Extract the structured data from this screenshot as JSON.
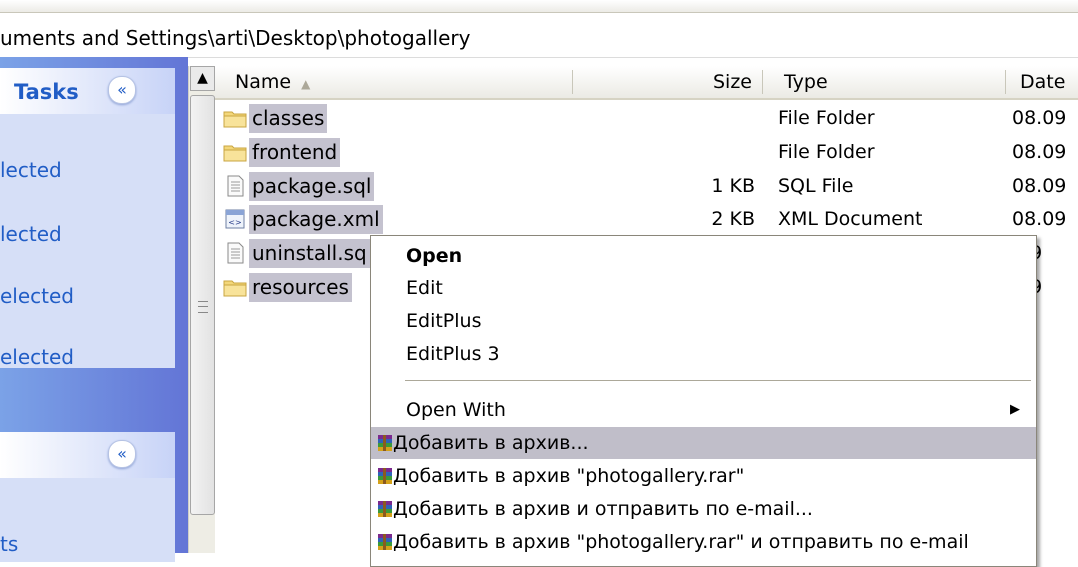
{
  "address": {
    "path": "uments and Settings\\arti\\Desktop\\photogallery"
  },
  "task_pane": {
    "panel1": {
      "header": "Tasks",
      "items": [
        "lected",
        "lected",
        "elected",
        "elected"
      ]
    },
    "panel2": {
      "header": "",
      "items": [
        "ts"
      ]
    },
    "collapse_glyph": "«"
  },
  "columns": {
    "name": "Name",
    "size": "Size",
    "type": "Type",
    "date": "Date"
  },
  "files": [
    {
      "name": "classes",
      "size": "",
      "type": "File Folder",
      "date": "08.09",
      "icon": "folder-icon"
    },
    {
      "name": "frontend",
      "size": "",
      "type": "File Folder",
      "date": "08.09",
      "icon": "folder-icon"
    },
    {
      "name": "package.sql",
      "size": "1 KB",
      "type": "SQL File",
      "date": "08.09",
      "icon": "text-file-icon"
    },
    {
      "name": "package.xml",
      "size": "2 KB",
      "type": "XML Document",
      "date": "08.09",
      "icon": "xml-file-icon"
    },
    {
      "name": "uninstall.sq",
      "size": "",
      "type": "",
      "date": ".09",
      "icon": "text-file-icon"
    },
    {
      "name": "resources",
      "size": "",
      "type": "",
      "date": ".09",
      "icon": "folder-icon"
    }
  ],
  "context_menu": {
    "open": "Open",
    "edit": "Edit",
    "editplus": "EditPlus",
    "editplus3": "EditPlus 3",
    "open_with": "Open With",
    "add_archive": "Добавить в архив...",
    "add_archive_named": "Добавить в архив \"photogallery.rar\"",
    "add_archive_email": "Добавить в архив и отправить по e-mail...",
    "add_archive_named_email": "Добавить в архив \"photogallery.rar\" и отправить по e-mail"
  },
  "colors": {
    "highlight": "#c0bec9",
    "selection": "#c4c2cf",
    "task_blue": "#215dc6"
  }
}
